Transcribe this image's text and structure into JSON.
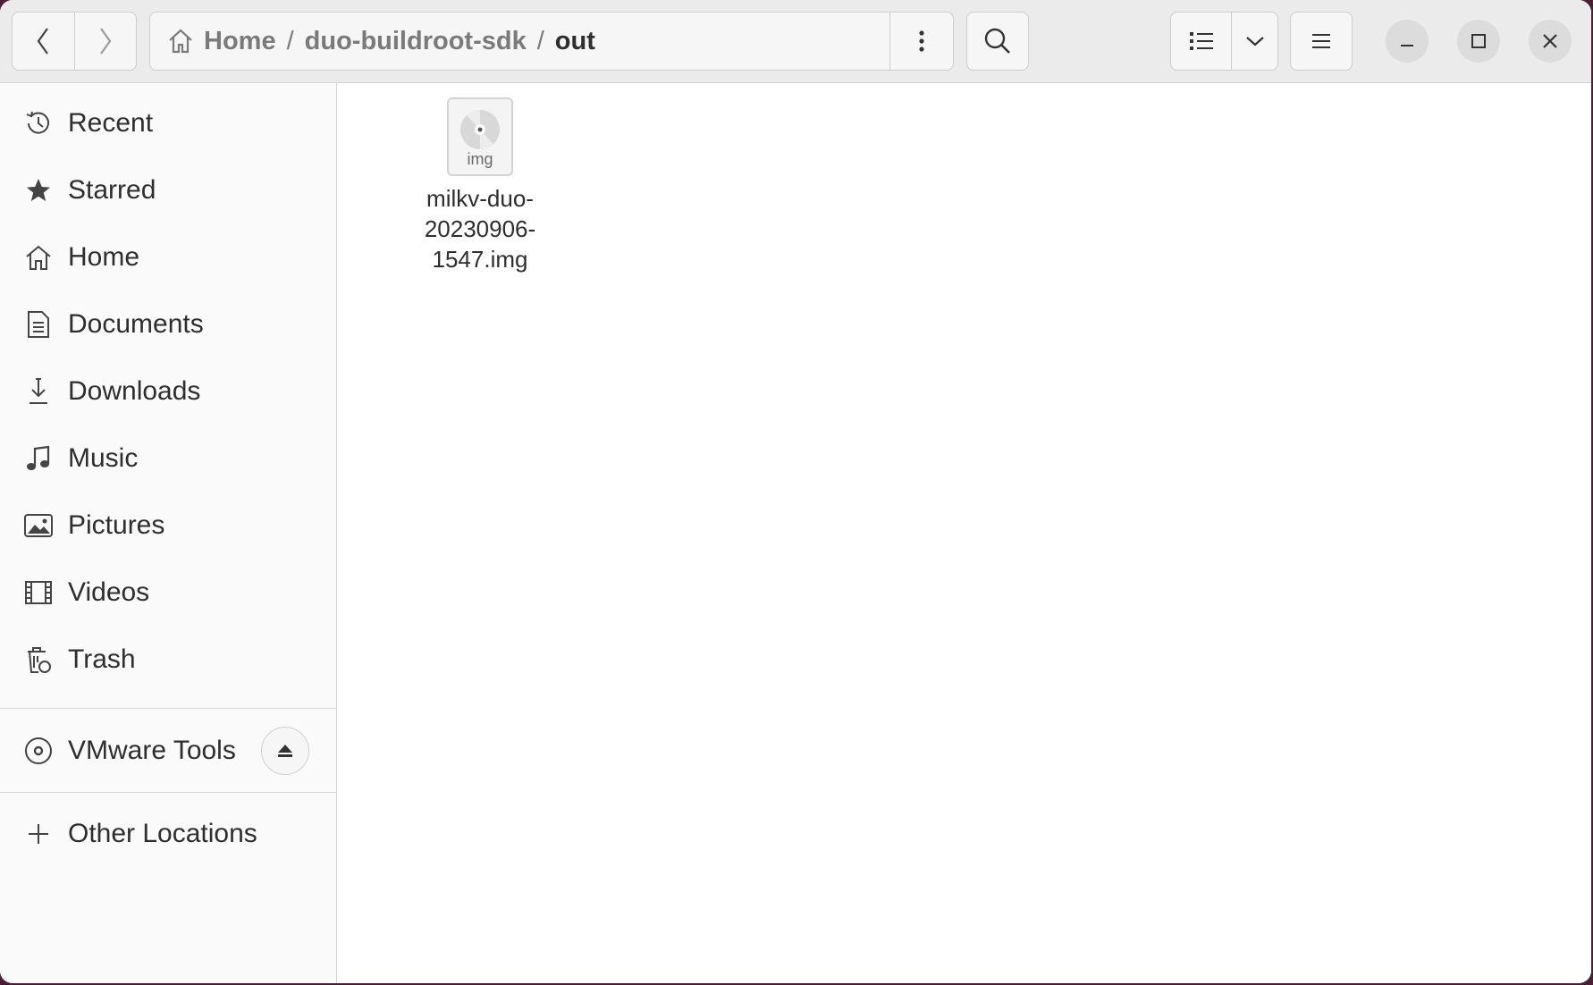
{
  "window": {
    "title": "out"
  },
  "breadcrumb": {
    "items": [
      {
        "label": "Home"
      },
      {
        "label": "duo-buildroot-sdk"
      },
      {
        "label": "out"
      }
    ],
    "separator": "/"
  },
  "sidebar": {
    "items": [
      {
        "label": "Recent",
        "icon": "clock-icon"
      },
      {
        "label": "Starred",
        "icon": "star-icon"
      },
      {
        "label": "Home",
        "icon": "home-icon"
      },
      {
        "label": "Documents",
        "icon": "document-icon"
      },
      {
        "label": "Downloads",
        "icon": "download-icon"
      },
      {
        "label": "Music",
        "icon": "music-icon"
      },
      {
        "label": "Pictures",
        "icon": "picture-icon"
      },
      {
        "label": "Videos",
        "icon": "film-icon"
      },
      {
        "label": "Trash",
        "icon": "trash-icon"
      }
    ],
    "devices": [
      {
        "label": "VMware Tools",
        "icon": "disc-icon",
        "action_icon": "eject-icon"
      }
    ],
    "other": {
      "label": "Other Locations",
      "icon": "plus-icon"
    }
  },
  "files": [
    {
      "name_lines": [
        "milkv-duo-",
        "20230906-",
        "1547.img"
      ],
      "thumb_label": "img",
      "icon": "disc-image-icon"
    }
  ],
  "colors": {
    "accent": "#e95420",
    "background": "#ffffff",
    "sidebar": "#fafafa",
    "headerbar": "#ebebeb"
  }
}
